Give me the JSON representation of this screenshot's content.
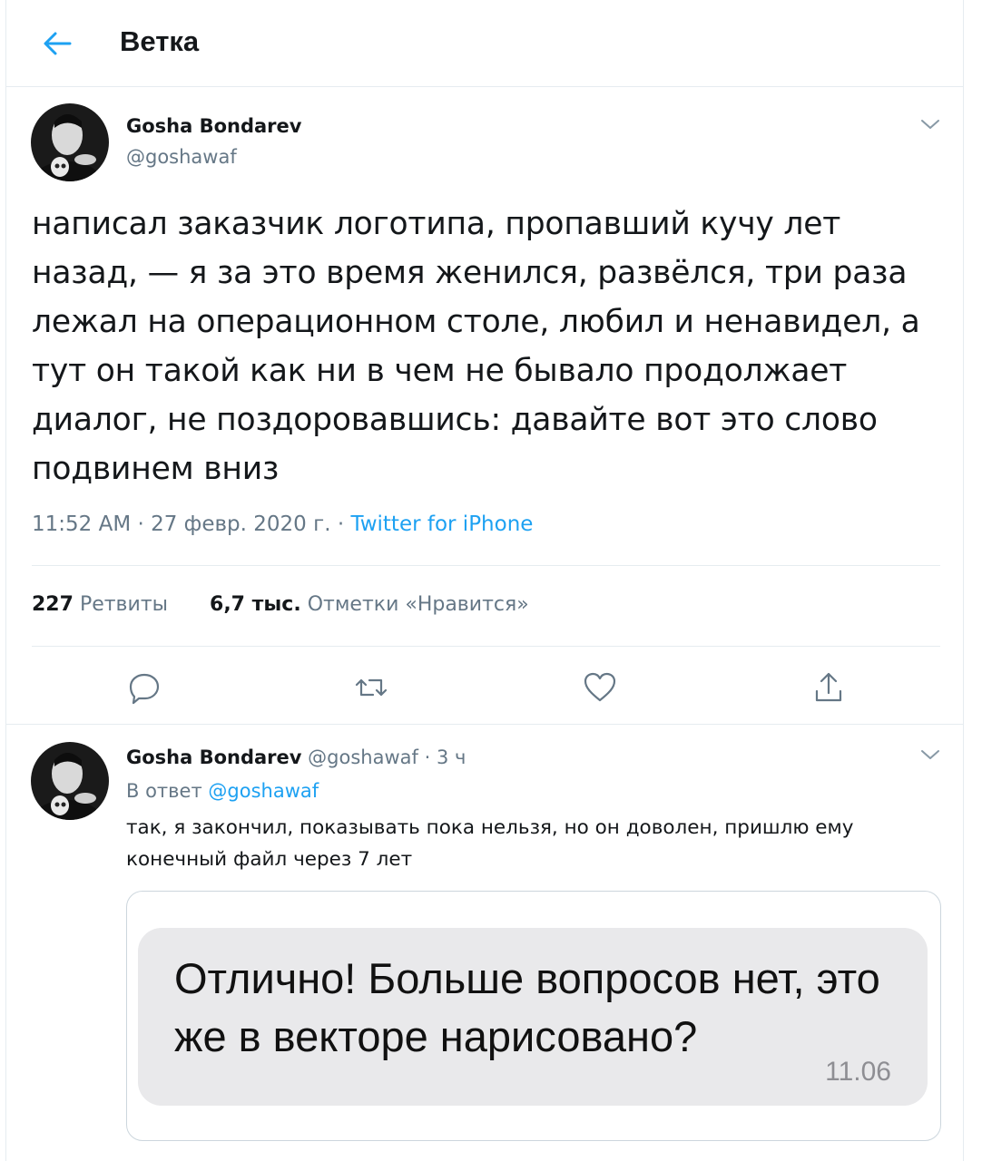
{
  "header": {
    "title": "Ветка"
  },
  "tweet": {
    "author_name": "Gosha Bondarev",
    "author_handle": "@goshawaf",
    "text": "написал заказчик логотипа, пропавший кучу лет назад, — я за это  время женился, развёлся, три раза лежал на операционном столе, любил и ненавидел, а тут он такой как ни в чем не бывало продолжает диалог, не поздоровавшись: давайте вот это слово подвинем вниз",
    "time": "11:52 AM",
    "date": "27 февр. 2020 г.",
    "source": "Twitter for iPhone",
    "retweets_count": "227",
    "retweets_label": "Ретвиты",
    "likes_count": "6,7 тыс.",
    "likes_label": "Отметки «Нравится»"
  },
  "reply": {
    "author_name": "Gosha Bondarev",
    "author_handle": "@goshawaf",
    "age": "3 ч",
    "in_reply_prefix": "В ответ",
    "in_reply_handle": "@goshawaf",
    "text": "так, я закончил, показывать пока нельзя, но он доволен, пришлю ему конечный файл через 7 лет",
    "media": {
      "message": "Отлично! Больше вопросов нет, это же в векторе нарисовано?",
      "time": "11.06"
    }
  },
  "icons": {
    "back": "arrow-left-icon",
    "chevron": "chevron-down-icon",
    "reply": "reply-icon",
    "retweet": "retweet-icon",
    "like": "heart-icon",
    "share": "share-icon"
  },
  "colors": {
    "accent": "#1da1f2",
    "secondary_text": "#657786",
    "border": "#e6ecf0"
  }
}
